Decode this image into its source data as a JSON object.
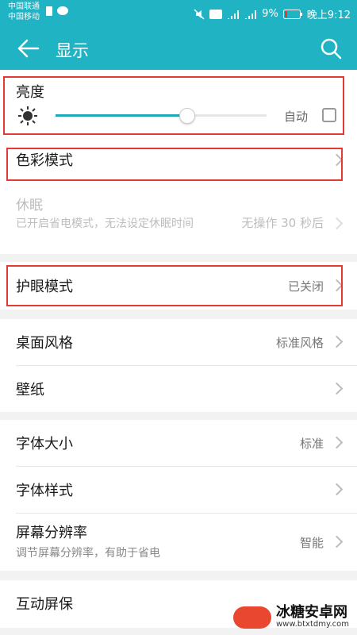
{
  "status": {
    "carrier1": "中国联通",
    "carrier2": "中国移动",
    "battery": "9%",
    "time": "晚上9:12"
  },
  "appbar": {
    "title": "显示"
  },
  "brightness": {
    "label": "亮度",
    "auto_label": "自动",
    "level_fraction": 0.62,
    "auto_checked": false
  },
  "color_mode": {
    "label": "色彩模式"
  },
  "sleep": {
    "label": "休眠",
    "sub": "已开启省电模式，无法设定休眠时间",
    "value": "无操作 30 秒后"
  },
  "eye_mode": {
    "label": "护眼模式",
    "value": "已关闭"
  },
  "desktop_style": {
    "label": "桌面风格",
    "value": "标准风格"
  },
  "wallpaper": {
    "label": "壁纸"
  },
  "font_size": {
    "label": "字体大小",
    "value": "标准"
  },
  "font_style": {
    "label": "字体样式"
  },
  "resolution": {
    "label": "屏幕分辨率",
    "sub": "调节屏幕分辨率，有助于省电",
    "value": "智能"
  },
  "screensaver": {
    "label": "互动屏保"
  },
  "watermark": {
    "name": "冰糖安卓网",
    "url": "www.btxtdmy.com"
  },
  "colors": {
    "accent": "#1fb3c4",
    "highlight": "#e53935"
  }
}
